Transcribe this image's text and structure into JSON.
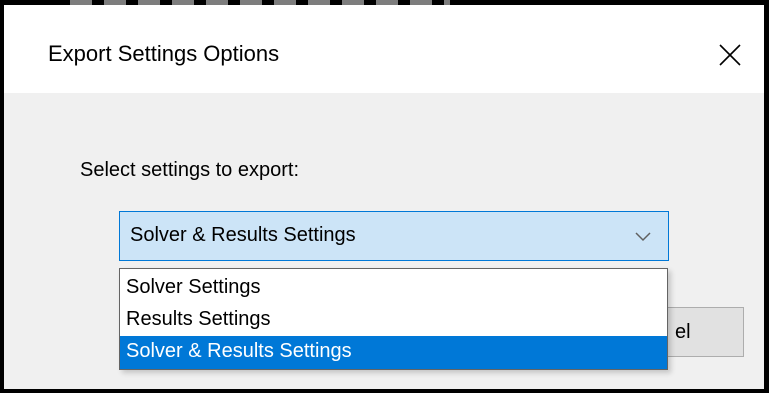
{
  "dialog": {
    "title": "Export Settings Options",
    "close_icon": "close-icon",
    "prompt": "Select settings to export:"
  },
  "combo": {
    "selected_value": "Solver & Results Settings",
    "chevron_icon": "chevron-down-icon",
    "options": [
      {
        "label": "Solver Settings",
        "selected": false
      },
      {
        "label": "Results Settings",
        "selected": false
      },
      {
        "label": "Solver & Results Settings",
        "selected": true
      }
    ]
  },
  "buttons": {
    "cancel_visible_fragment": "el"
  },
  "colors": {
    "accent": "#0078d7",
    "combo_background": "#cce4f7",
    "dialog_background": "#f0f0f0"
  }
}
